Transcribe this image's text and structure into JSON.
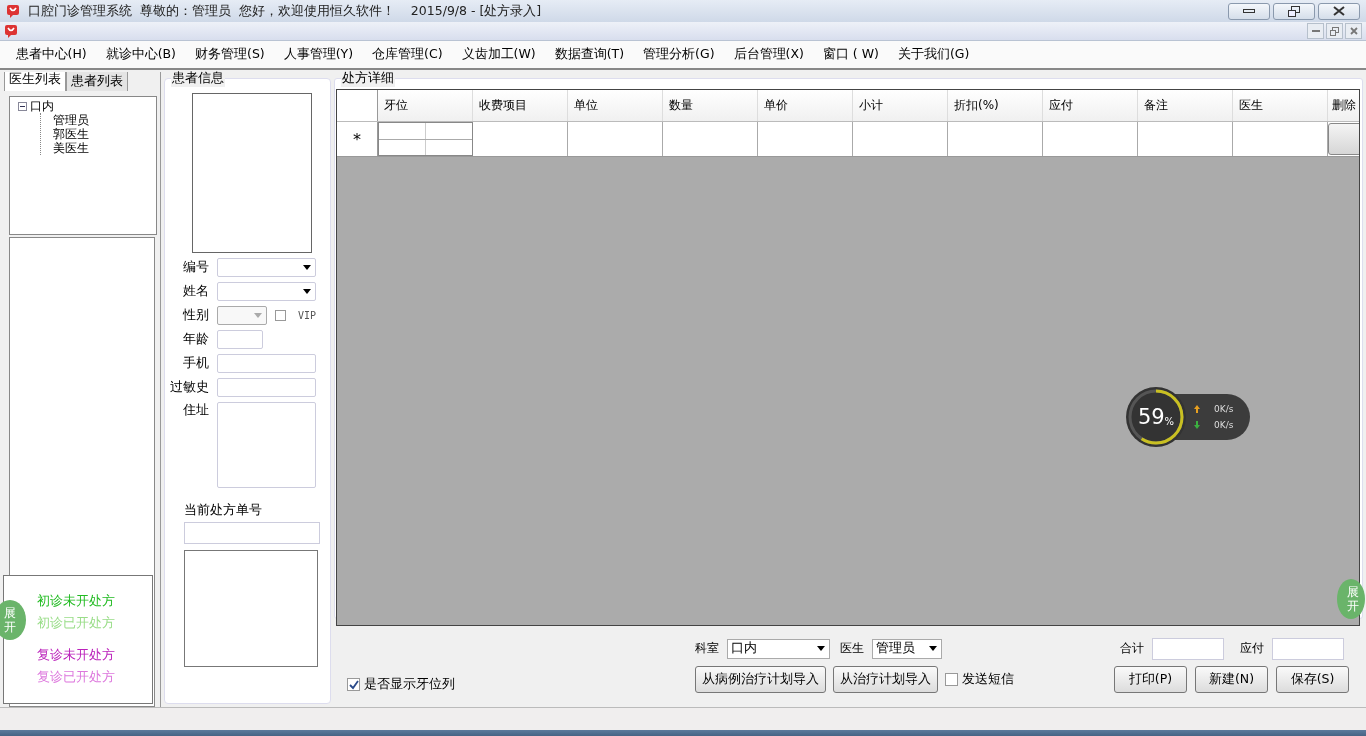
{
  "window": {
    "title": "口腔门诊管理系统  尊敬的：管理员  您好，欢迎使用恒久软件！",
    "subtitle": "2015/9/8 - [处方录入]"
  },
  "menu": [
    "患者中心(H)",
    "就诊中心(B)",
    "财务管理(S)",
    "人事管理(Y)",
    "仓库管理(C)",
    "义齿加工(W)",
    "数据查询(T)",
    "管理分析(G)",
    "后台管理(X)",
    "窗口 ( W)",
    "关于我们(G)"
  ],
  "left_tabs": [
    {
      "label": "医生列表",
      "selected": true
    },
    {
      "label": "患者列表",
      "selected": false
    }
  ],
  "tree": [
    {
      "label": "口内",
      "expanded": true,
      "children": [
        {
          "label": "管理员"
        },
        {
          "label": "郭医生"
        },
        {
          "label": "美医生"
        }
      ]
    }
  ],
  "legend": [
    {
      "label": "初诊未开处方",
      "color": "#22bb22"
    },
    {
      "label": "初诊已开处方",
      "color": "#99dd88"
    },
    {
      "label": "复诊未开处方",
      "color": "#bb22bb"
    },
    {
      "label": "复诊已开处方",
      "color": "#dd77dd"
    }
  ],
  "expand_buttons": [
    "展开",
    "展开"
  ],
  "patient_info": {
    "title": "患者信息",
    "fields": [
      {
        "label": "编号",
        "kind": "dropdown"
      },
      {
        "label": "姓名",
        "kind": "dropdown"
      },
      {
        "label": "性别",
        "kind": "gender"
      },
      {
        "label": "年龄",
        "kind": "short"
      },
      {
        "label": "手机",
        "kind": "text"
      },
      {
        "label": "过敏史",
        "kind": "text"
      },
      {
        "label": "住址",
        "kind": "multiline"
      }
    ],
    "vip": {
      "label": "VIP",
      "checked": false
    },
    "rx_label": "当前处方单号"
  },
  "grid": {
    "title": "处方详细",
    "columns": [
      "牙位",
      "收费项目",
      "单位",
      "数量",
      "单价",
      "小计",
      "折扣(%)",
      "应付",
      "备注",
      "医生",
      "删除"
    ],
    "new_row_marker": "*"
  },
  "bottom": {
    "show_teeth": {
      "label": "是否显示牙位列",
      "checked": true
    },
    "dept": {
      "label": "科室",
      "value": "口内"
    },
    "doctor": {
      "label": "医生",
      "value": "管理员"
    },
    "total_label": "合计",
    "payable_label": "应付",
    "import_buttons": [
      "从病例治疗计划导入",
      "从治疗计划导入"
    ],
    "sms": {
      "label": "发送短信",
      "checked": false
    },
    "action_buttons": [
      "打印(P)",
      "新建(N)",
      "保存(S)"
    ]
  },
  "net_widget": {
    "percent": "59",
    "unit": "%",
    "upload": "0K/s",
    "download": "0K/s"
  }
}
